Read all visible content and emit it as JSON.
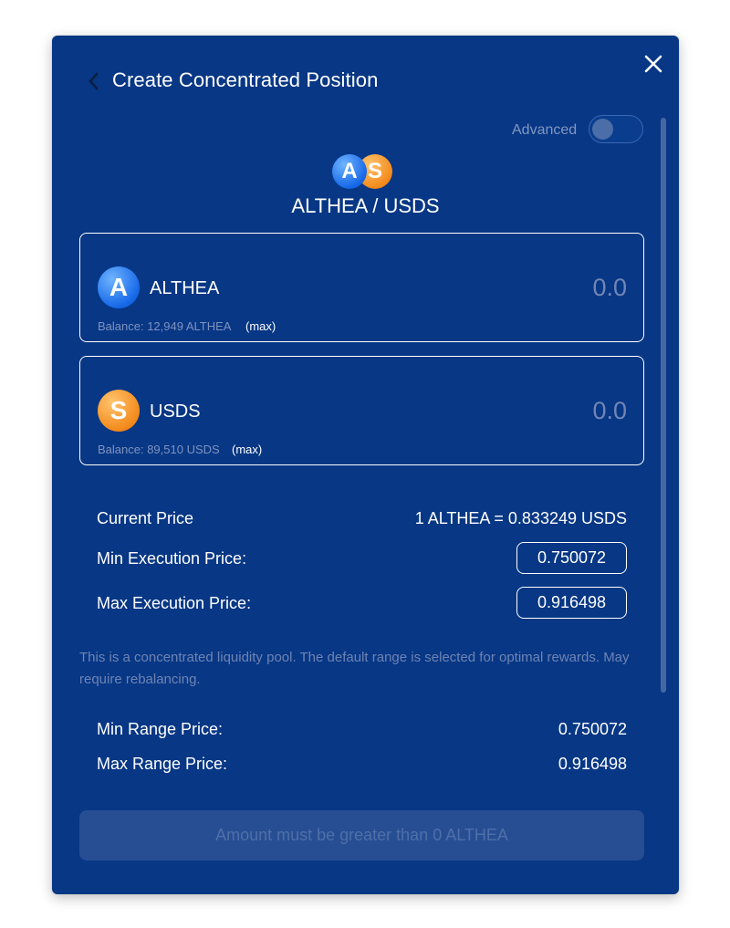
{
  "header": {
    "title": "Create Concentrated Position"
  },
  "advanced": {
    "label": "Advanced",
    "enabled": false
  },
  "pair": {
    "name": "ALTHEA / USDS",
    "token_a_glyph": "A",
    "token_b_glyph": "S"
  },
  "tokens": [
    {
      "symbol": "ALTHEA",
      "glyph": "A",
      "amount_placeholder": "0.0",
      "balance": "Balance: 12,949 ALTHEA",
      "max_label": "(max)"
    },
    {
      "symbol": "USDS",
      "glyph": "S",
      "amount_placeholder": "0.0",
      "balance": "Balance: 89,510 USDS",
      "max_label": "(max)"
    }
  ],
  "prices": {
    "current_label": "Current Price",
    "current_value": "1 ALTHEA = 0.833249 USDS",
    "min_exec_label": "Min Execution Price:",
    "min_exec_value": "0.750072",
    "max_exec_label": "Max Execution Price:",
    "max_exec_value": "0.916498"
  },
  "info": {
    "text": "This is a concentrated liquidity pool. The default range is selected for optimal rewards. May require rebalancing."
  },
  "range": {
    "min_label": "Min Range Price:",
    "min_value": "0.750072",
    "max_label": "Max Range Price:",
    "max_value": "0.916498"
  },
  "submit": {
    "label": "Amount must be greater than 0 ALTHEA"
  },
  "colors": {
    "modal_bg": "#073785",
    "althea_coin": "#1668e8",
    "usds_coin": "#f38a1c",
    "muted_text": "#7286b4",
    "disabled_button": "#274e93"
  }
}
